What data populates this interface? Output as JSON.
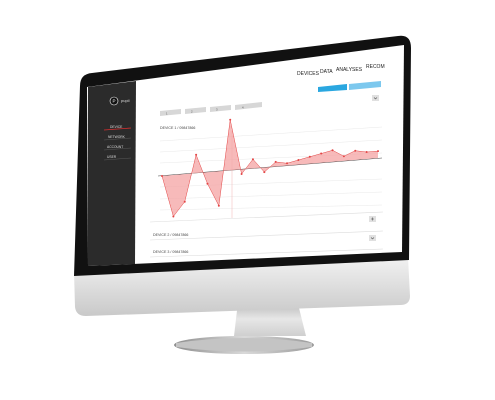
{
  "app": {
    "logo_letter": "P",
    "name": "pupil"
  },
  "nav": {
    "items": [
      "DEVICES",
      "DATA",
      "ANALYSES",
      "RECOM"
    ]
  },
  "top_buttons": [
    {
      "label": "",
      "color": "#2aa7e0"
    },
    {
      "label": "",
      "color": "#7cc8ee"
    }
  ],
  "sidebar": {
    "items": [
      "DEVICE",
      "NETWORK",
      "ACCOUNT",
      "USER"
    ],
    "active_index": 0
  },
  "tabs": [
    "1",
    "2",
    "3",
    "4"
  ],
  "panels": {
    "panel1_title": "DEVICE 1 / 09847866",
    "panel2_title": "DEVICE 2 / 09847866",
    "panel3_title": "DEVICE 3 / 09847866"
  },
  "chart_data": {
    "type": "area",
    "xlabel": "",
    "ylabel": "",
    "grid": true,
    "series": [
      {
        "values": [
          0,
          -18,
          -12,
          8,
          -5,
          -15,
          22,
          -2,
          4,
          -2,
          2,
          1,
          2,
          3,
          4,
          5,
          2,
          4,
          3,
          3
        ]
      }
    ],
    "ylim": [
      -22,
      25
    ],
    "fill_color": "#f4a3a3",
    "point_color": "#e34545",
    "line_color": "#e34545"
  },
  "colors": {
    "sidebar_bg": "#2b2b2b",
    "accent_red": "#d83030",
    "screen_bg": "#ffffff"
  }
}
